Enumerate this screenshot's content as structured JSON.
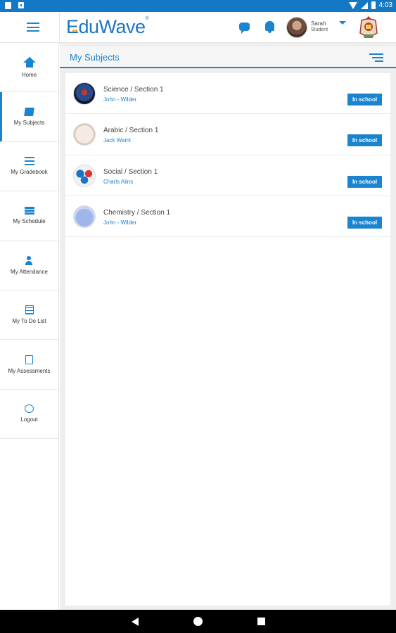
{
  "status_bar": {
    "time": "4:03"
  },
  "header": {
    "logo_text": "EduWave",
    "logo_mark": "®",
    "user": {
      "name": "Sarah",
      "role": "Student"
    }
  },
  "sidebar": {
    "items": [
      {
        "label": "Home",
        "icon": "home-icon"
      },
      {
        "label": "My Subjects",
        "icon": "book-icon",
        "active": true
      },
      {
        "label": "My Gradebook",
        "icon": "gradebook-icon"
      },
      {
        "label": "My Schedule",
        "icon": "schedule-icon"
      },
      {
        "label": "My Attendance",
        "icon": "attendance-icon"
      },
      {
        "label": "My To Do List",
        "icon": "todo-list-icon"
      },
      {
        "label": "My Assessments",
        "icon": "assessment-icon"
      },
      {
        "label": "Logout",
        "icon": "logout-icon"
      }
    ]
  },
  "main": {
    "title": "My Subjects",
    "subjects": [
      {
        "name": "Science / Section 1",
        "teacher": "John  - Wilder",
        "status": "In school",
        "icon": "science-icon"
      },
      {
        "name": "Arabic  / Section 1",
        "teacher": "Jack  Wami",
        "status": "In school",
        "icon": "arabic-icon"
      },
      {
        "name": "Social / Section 1",
        "teacher": "Charls  Alins",
        "status": "In school",
        "icon": "social-icon"
      },
      {
        "name": "Chemistry / Section 1",
        "teacher": "John  - Wilder",
        "status": "In school",
        "icon": "chemistry-icon"
      }
    ]
  },
  "colors": {
    "accent": "#1b84cf",
    "status_bar": "#1479c4",
    "logo_dots": "#f29a1c"
  }
}
